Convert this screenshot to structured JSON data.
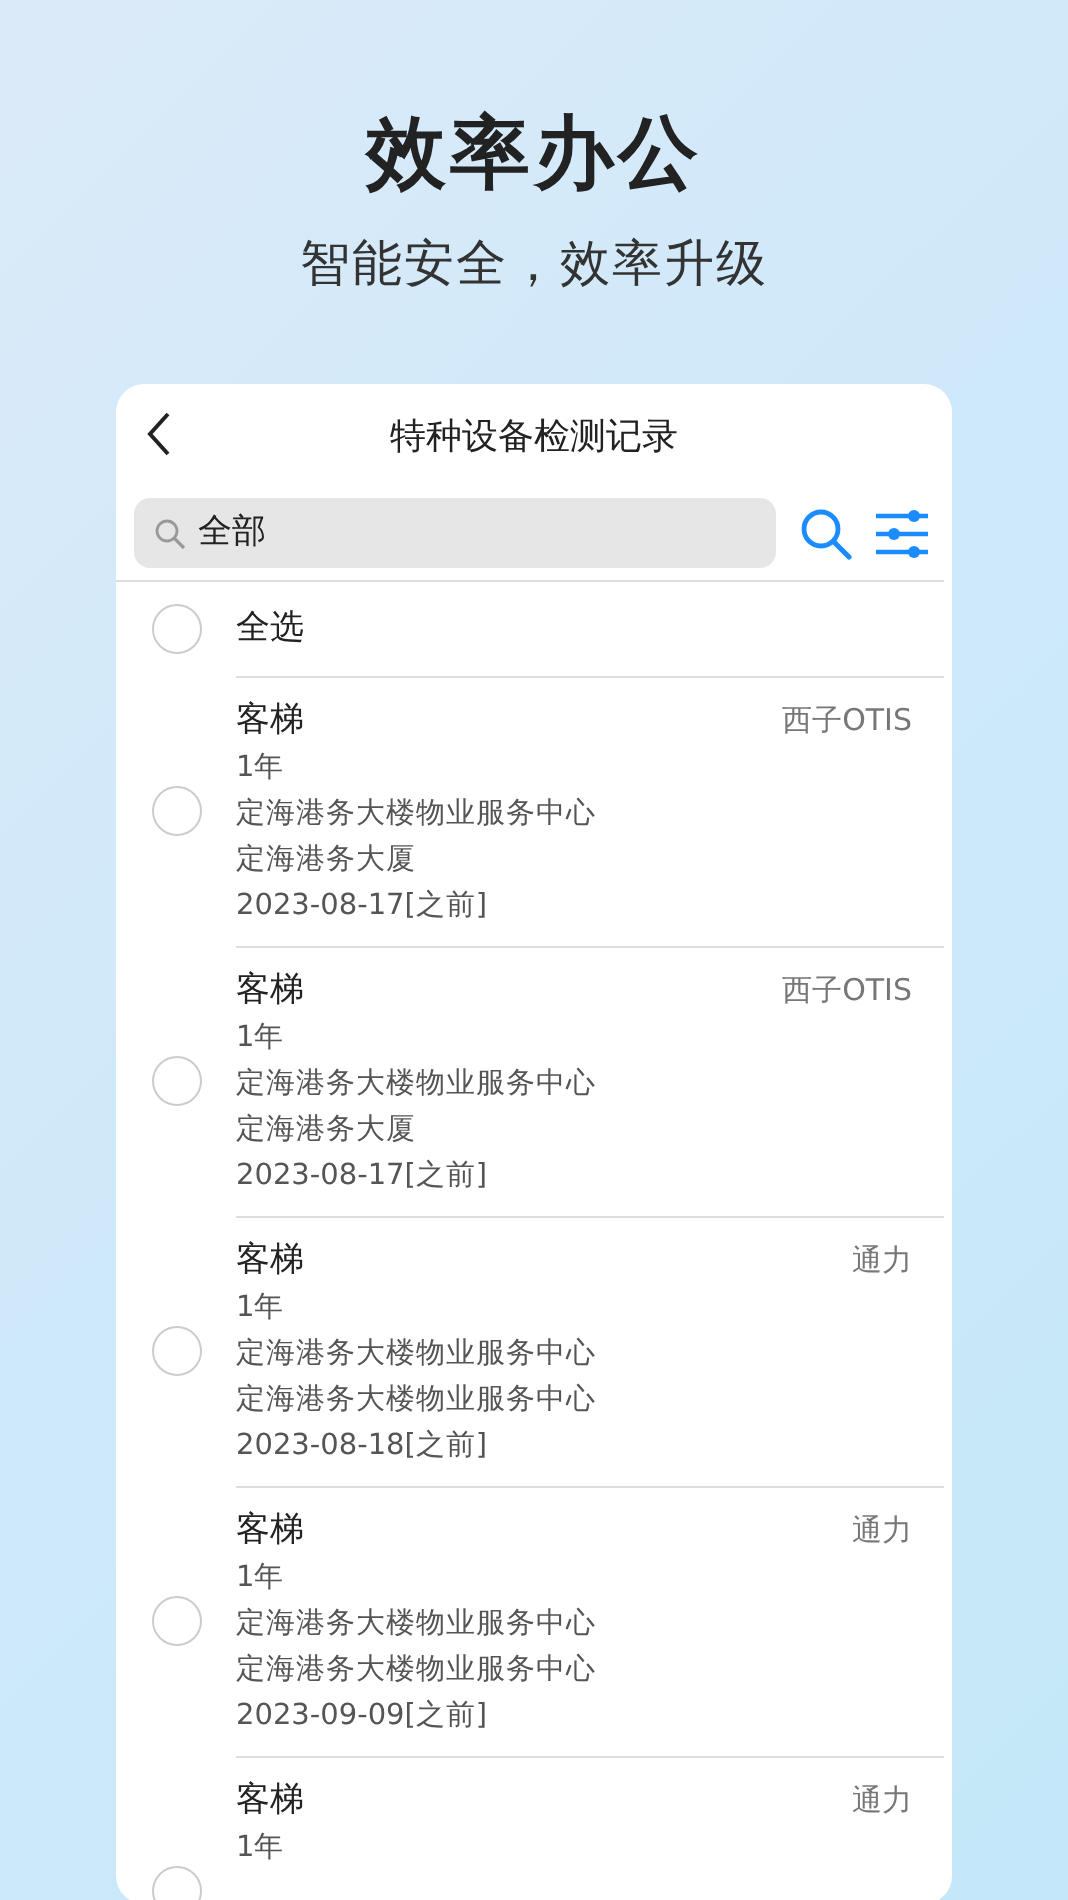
{
  "hero": {
    "title": "效率办公",
    "subtitle": "智能安全，效率升级"
  },
  "header": {
    "title": "特种设备检测记录"
  },
  "search": {
    "value": "全部"
  },
  "select_all": {
    "label": "全选",
    "checked": false
  },
  "records": [
    {
      "type": "客梯",
      "vendor": "西子OTIS",
      "period": "1年",
      "lines": [
        "定海港务大楼物业服务中心",
        "定海港务大厦",
        "2023-08-17[之前]"
      ],
      "checked": false
    },
    {
      "type": "客梯",
      "vendor": "西子OTIS",
      "period": "1年",
      "lines": [
        "定海港务大楼物业服务中心",
        "定海港务大厦",
        "2023-08-17[之前]"
      ],
      "checked": false
    },
    {
      "type": "客梯",
      "vendor": "通力",
      "period": "1年",
      "lines": [
        "定海港务大楼物业服务中心",
        "定海港务大楼物业服务中心",
        "2023-08-18[之前]"
      ],
      "checked": false
    },
    {
      "type": "客梯",
      "vendor": "通力",
      "period": "1年",
      "lines": [
        "定海港务大楼物业服务中心",
        "定海港务大楼物业服务中心",
        "2023-09-09[之前]"
      ],
      "checked": false
    },
    {
      "type": "客梯",
      "vendor": "通力",
      "period": "1年",
      "checked": false
    }
  ]
}
